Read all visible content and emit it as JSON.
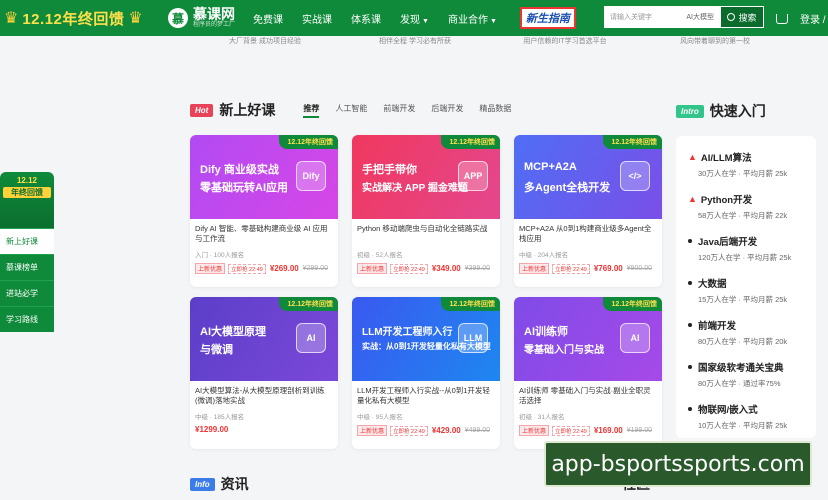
{
  "header": {
    "promo_title": "12.12年终回馈",
    "logo_name": "慕课网",
    "logo_slogan": "程序员的梦工厂",
    "nav": [
      "免费课",
      "实战课",
      "体系课",
      "发现",
      "商业合作"
    ],
    "guide_badge": "新生指南",
    "search_placeholder": "请输入关键字",
    "search_suggest": "AI大模型",
    "search_button": "搜索",
    "login": "登录 / 注册"
  },
  "hints": [
    "大厂背景 成功项目经验",
    "相伴全程 学习必有所获",
    "用户信赖的IT学习首选平台",
    "风向带着聊到的第一校"
  ],
  "side": {
    "badge_top": "12.12",
    "badge_main": "年终回馈",
    "items": [
      "新上好课",
      "慕课榜单",
      "进站必学",
      "学习路线"
    ]
  },
  "new_courses": {
    "tag": "Hot",
    "title": "新上好课",
    "tabs": [
      "推荐",
      "人工智能",
      "前端开发",
      "后端开发",
      "精品数据"
    ]
  },
  "courses": [
    {
      "line1": "Dify 商业级实战",
      "line2": "零基础玩转AI应用",
      "icon": "Dify",
      "title": "Dify AI 智能、零基础构建商业级 AI 应用与工作流",
      "meta": "入门 · 100人报名",
      "now": "¥269.00",
      "old": "¥299.00",
      "grad": "linear-gradient(120deg,#b24bf3,#d646e6)"
    },
    {
      "line1": "手把手带你",
      "line2": "实战解决 APP 掘金难题",
      "icon": "APP",
      "title": "Python 移动端爬虫与自动化全链路实战",
      "meta": "初级 · 52人报名",
      "now": "¥349.00",
      "old": "¥399.00",
      "grad": "linear-gradient(120deg,#f0385e,#e4478e)"
    },
    {
      "line1": "MCP+A2A",
      "line2": "多Agent全栈开发",
      "icon": "</>",
      "title": "MCP+A2A 从0到1构建商业级多Agent全栈应用",
      "meta": "中级 · 204人报名",
      "now": "¥769.00",
      "old": "¥900.00",
      "grad": "linear-gradient(120deg,#4f6ef4,#7a4fe8)"
    },
    {
      "line1": "AI大模型原理",
      "line2": "与微调",
      "icon": "AI",
      "title": "AI大模型算法-从大模型原理剖析到训练(微调)落地实战",
      "meta": "中级 · 185人报名",
      "now": "¥1299.00",
      "old": "",
      "grad": "linear-gradient(120deg,#5b3fc8,#7c48d9)"
    },
    {
      "line1": "LLM开发工程师入行",
      "line2": "实战：从0到1开发轻量化私有大模型",
      "icon": "LLM",
      "title": "LLM开发工程师入行实战--从0到1开发轻量化私有大模型",
      "meta": "中级 · 95人报名",
      "now": "¥429.00",
      "old": "¥499.00",
      "grad": "linear-gradient(120deg,#3a59f0,#1e87f0)"
    },
    {
      "line1": "AI训练师",
      "line2": "零基础入门与实战",
      "icon": "AI",
      "title": "AI训练师 零基础入门与实战·副业全职灵活选择",
      "meta": "初级 · 31人报名",
      "now": "¥169.00",
      "old": "¥199.00",
      "grad": "linear-gradient(120deg,#7f4be8,#a64ae8)"
    }
  ],
  "course_ribbon": "12.12年终回馈",
  "course_price_tag": "上新优惠",
  "course_count_tag": "立即抢 22:49",
  "quick": {
    "tag": "Intro",
    "title": "快速入门",
    "items": [
      {
        "name": "AI/LLM算法",
        "stat": "30万人在学 · 平均月薪 25k",
        "hot": true
      },
      {
        "name": "Python开发",
        "stat": "58万人在学 · 平均月薪 22k",
        "hot": true
      },
      {
        "name": "Java后端开发",
        "stat": "120万人在学 · 平均月薪 25k",
        "hot": false
      },
      {
        "name": "大数据",
        "stat": "15万人在学 · 平均月薪 25k",
        "hot": false
      },
      {
        "name": "前端开发",
        "stat": "80万人在学 · 平均月薪 20k",
        "hot": false
      },
      {
        "name": "国家级软考通关宝典",
        "stat": "80万人在学 · 通过率75%",
        "hot": false
      },
      {
        "name": "物联网/嵌入式",
        "stat": "10万人在学 · 平均月薪 25k",
        "hot": false
      }
    ]
  },
  "bottom": {
    "info_tag": "Info",
    "info_title": "资讯",
    "more": "更多 >",
    "social_title": "社区"
  },
  "watermark": "app-bsportssports.com"
}
